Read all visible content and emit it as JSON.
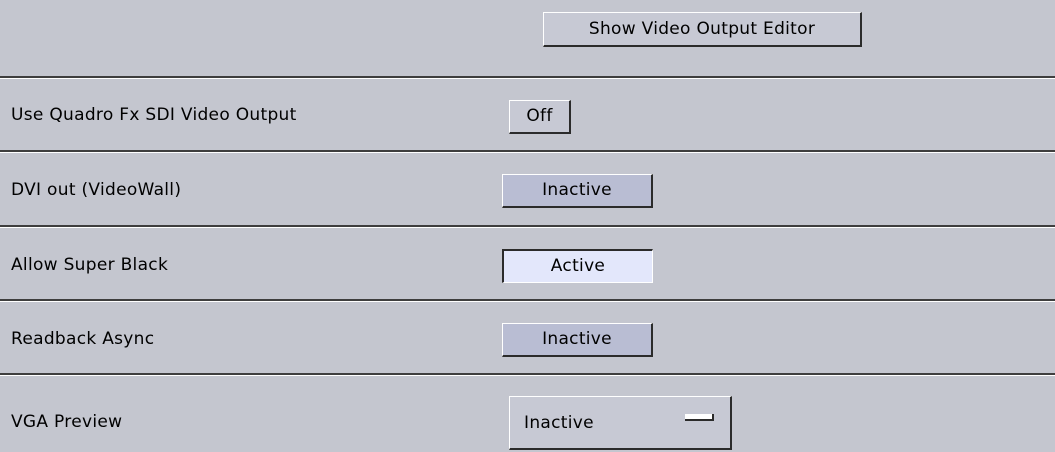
{
  "editor_button": {
    "label": "Show Video Output Editor"
  },
  "settings": [
    {
      "label": "Use Quadro Fx SDI Video Output",
      "value": "Off",
      "state": "off"
    },
    {
      "label": "DVI out (VideoWall)",
      "value": "Inactive",
      "state": "inactive"
    },
    {
      "label": "Allow Super Black",
      "value": "Active",
      "state": "active"
    },
    {
      "label": "Readback Async",
      "value": "Inactive",
      "state": "inactive"
    },
    {
      "label": "VGA Preview",
      "value": "Inactive",
      "state": "dropdown"
    }
  ],
  "colors": {
    "panel_bg": "#c4c6cf",
    "button_bg": "#c7c9d4",
    "toggle_inactive_bg": "#b9bdd3",
    "toggle_active_bg": "#e3e7fb",
    "divider": "#3e3e3e"
  }
}
